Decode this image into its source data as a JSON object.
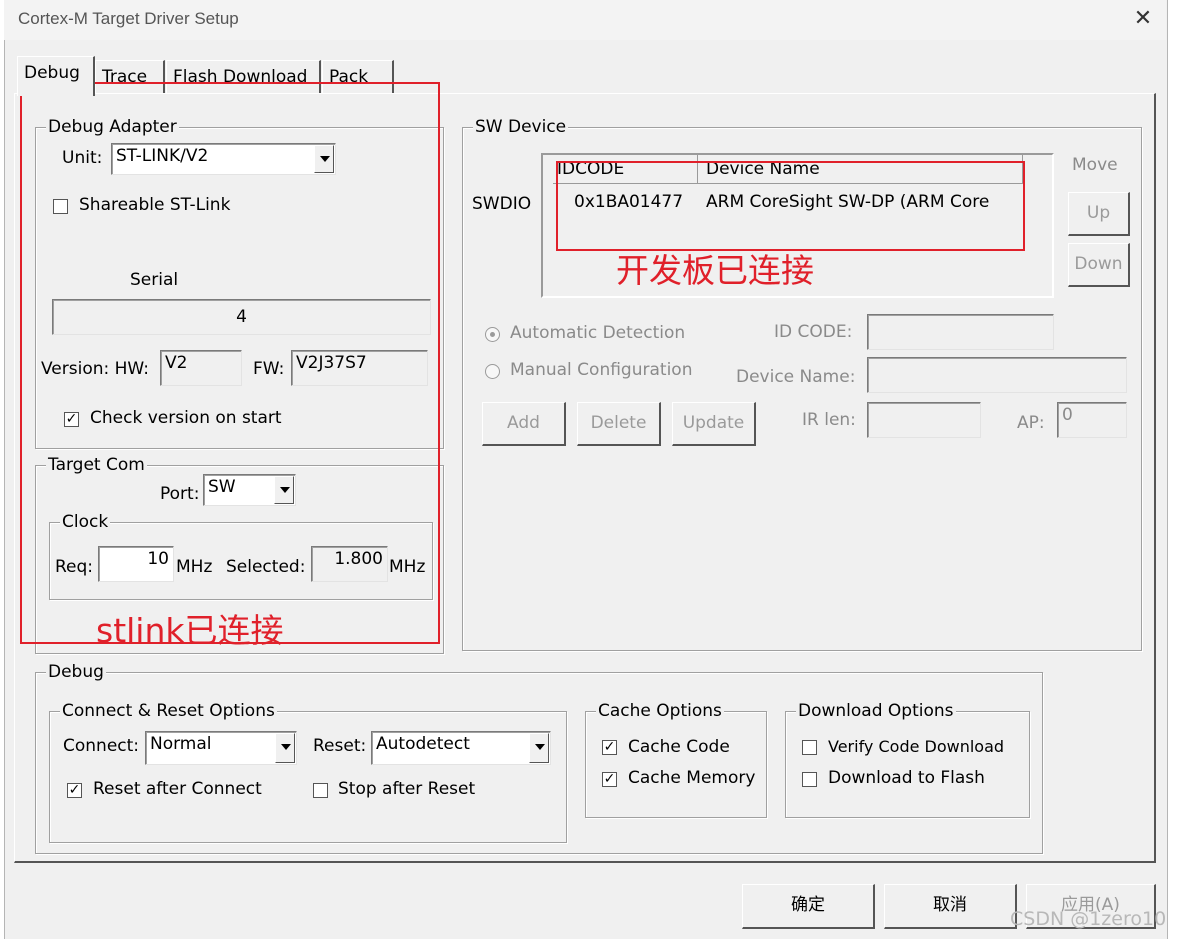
{
  "window": {
    "title": "Cortex-M Target Driver Setup",
    "close_glyph": "✕"
  },
  "tabs": [
    {
      "label": "Debug",
      "active": true
    },
    {
      "label": "Trace"
    },
    {
      "label": "Flash Download"
    },
    {
      "label": "Pack"
    }
  ],
  "debug_adapter": {
    "group_label": "Debug Adapter",
    "unit_label": "Unit:",
    "unit_value": "ST-LINK/V2",
    "shareable_label": "Shareable ST-Link",
    "shareable_checked": false,
    "serial_label": "Serial",
    "serial_value": "4",
    "version_label": "Version: HW:",
    "hw_value": "V2",
    "fw_label": "FW:",
    "fw_value": "V2J37S7",
    "check_version_label": "Check version on start",
    "check_version_checked": true
  },
  "target_com": {
    "group_label": "Target Com",
    "port_label": "Port:",
    "port_value": "SW",
    "clock_label": "Clock",
    "req_label": "Req:",
    "req_value": "10",
    "mhz1": "MHz",
    "selected_label": "Selected:",
    "selected_value": "1.800",
    "mhz2": "MHz"
  },
  "sw_device": {
    "group_label": "SW Device",
    "swdio_label": "SWDIO",
    "columns": [
      "IDCODE",
      "Device Name"
    ],
    "row": {
      "idcode": "0x1BA01477",
      "device_name": "ARM CoreSight SW-DP (ARM Core"
    },
    "move_label": "Move",
    "up_label": "Up",
    "down_label": "Down",
    "auto_detect_label": "Automatic Detection",
    "manual_config_label": "Manual Configuration",
    "id_code_label": "ID CODE:",
    "device_name_label": "Device Name:",
    "add_label": "Add",
    "delete_label": "Delete",
    "update_label": "Update",
    "ir_len_label": "IR len:",
    "ap_label": "AP:",
    "ap_value": "0"
  },
  "debug": {
    "group_label": "Debug",
    "connect_reset": {
      "group_label": "Connect & Reset Options",
      "connect_label": "Connect:",
      "connect_value": "Normal",
      "reset_label": "Reset:",
      "reset_value": "Autodetect",
      "reset_after_connect_label": "Reset after Connect",
      "reset_after_connect_checked": true,
      "stop_after_reset_label": "Stop after Reset",
      "stop_after_reset_checked": false
    },
    "cache": {
      "group_label": "Cache Options",
      "cache_code_label": "Cache Code",
      "cache_memory_label": "Cache Memory"
    },
    "download": {
      "group_label": "Download Options",
      "verify_label": "Verify Code Download",
      "download_flash_label": "Download to Flash"
    }
  },
  "annotations": {
    "stlink_text": "stlink已连接",
    "board_text": "开发板已连接",
    "color": "#e0202a"
  },
  "footer": {
    "ok_label": "确定",
    "cancel_label": "取消",
    "apply_label": "应用(A)"
  },
  "watermark": "CSDN @1zero10"
}
